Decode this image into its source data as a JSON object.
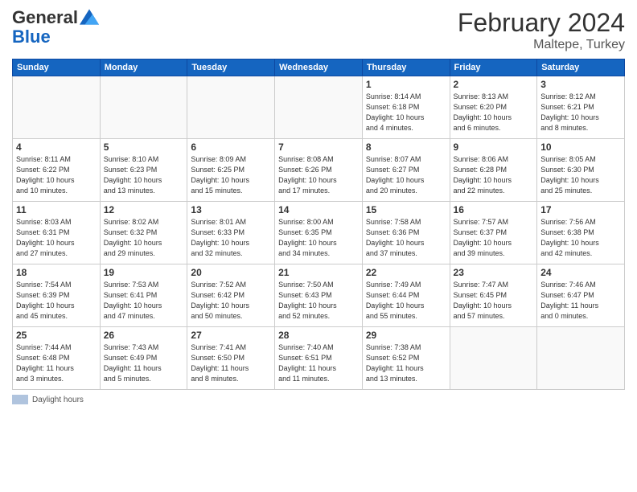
{
  "header": {
    "logo_general": "General",
    "logo_blue": "Blue",
    "title": "February 2024",
    "subtitle": "Maltepe, Turkey"
  },
  "footer": {
    "legend_label": "Daylight hours"
  },
  "days_of_week": [
    "Sunday",
    "Monday",
    "Tuesday",
    "Wednesday",
    "Thursday",
    "Friday",
    "Saturday"
  ],
  "weeks": [
    [
      {
        "day": "",
        "info": ""
      },
      {
        "day": "",
        "info": ""
      },
      {
        "day": "",
        "info": ""
      },
      {
        "day": "",
        "info": ""
      },
      {
        "day": "1",
        "info": "Sunrise: 8:14 AM\nSunset: 6:18 PM\nDaylight: 10 hours\nand 4 minutes."
      },
      {
        "day": "2",
        "info": "Sunrise: 8:13 AM\nSunset: 6:20 PM\nDaylight: 10 hours\nand 6 minutes."
      },
      {
        "day": "3",
        "info": "Sunrise: 8:12 AM\nSunset: 6:21 PM\nDaylight: 10 hours\nand 8 minutes."
      }
    ],
    [
      {
        "day": "4",
        "info": "Sunrise: 8:11 AM\nSunset: 6:22 PM\nDaylight: 10 hours\nand 10 minutes."
      },
      {
        "day": "5",
        "info": "Sunrise: 8:10 AM\nSunset: 6:23 PM\nDaylight: 10 hours\nand 13 minutes."
      },
      {
        "day": "6",
        "info": "Sunrise: 8:09 AM\nSunset: 6:25 PM\nDaylight: 10 hours\nand 15 minutes."
      },
      {
        "day": "7",
        "info": "Sunrise: 8:08 AM\nSunset: 6:26 PM\nDaylight: 10 hours\nand 17 minutes."
      },
      {
        "day": "8",
        "info": "Sunrise: 8:07 AM\nSunset: 6:27 PM\nDaylight: 10 hours\nand 20 minutes."
      },
      {
        "day": "9",
        "info": "Sunrise: 8:06 AM\nSunset: 6:28 PM\nDaylight: 10 hours\nand 22 minutes."
      },
      {
        "day": "10",
        "info": "Sunrise: 8:05 AM\nSunset: 6:30 PM\nDaylight: 10 hours\nand 25 minutes."
      }
    ],
    [
      {
        "day": "11",
        "info": "Sunrise: 8:03 AM\nSunset: 6:31 PM\nDaylight: 10 hours\nand 27 minutes."
      },
      {
        "day": "12",
        "info": "Sunrise: 8:02 AM\nSunset: 6:32 PM\nDaylight: 10 hours\nand 29 minutes."
      },
      {
        "day": "13",
        "info": "Sunrise: 8:01 AM\nSunset: 6:33 PM\nDaylight: 10 hours\nand 32 minutes."
      },
      {
        "day": "14",
        "info": "Sunrise: 8:00 AM\nSunset: 6:35 PM\nDaylight: 10 hours\nand 34 minutes."
      },
      {
        "day": "15",
        "info": "Sunrise: 7:58 AM\nSunset: 6:36 PM\nDaylight: 10 hours\nand 37 minutes."
      },
      {
        "day": "16",
        "info": "Sunrise: 7:57 AM\nSunset: 6:37 PM\nDaylight: 10 hours\nand 39 minutes."
      },
      {
        "day": "17",
        "info": "Sunrise: 7:56 AM\nSunset: 6:38 PM\nDaylight: 10 hours\nand 42 minutes."
      }
    ],
    [
      {
        "day": "18",
        "info": "Sunrise: 7:54 AM\nSunset: 6:39 PM\nDaylight: 10 hours\nand 45 minutes."
      },
      {
        "day": "19",
        "info": "Sunrise: 7:53 AM\nSunset: 6:41 PM\nDaylight: 10 hours\nand 47 minutes."
      },
      {
        "day": "20",
        "info": "Sunrise: 7:52 AM\nSunset: 6:42 PM\nDaylight: 10 hours\nand 50 minutes."
      },
      {
        "day": "21",
        "info": "Sunrise: 7:50 AM\nSunset: 6:43 PM\nDaylight: 10 hours\nand 52 minutes."
      },
      {
        "day": "22",
        "info": "Sunrise: 7:49 AM\nSunset: 6:44 PM\nDaylight: 10 hours\nand 55 minutes."
      },
      {
        "day": "23",
        "info": "Sunrise: 7:47 AM\nSunset: 6:45 PM\nDaylight: 10 hours\nand 57 minutes."
      },
      {
        "day": "24",
        "info": "Sunrise: 7:46 AM\nSunset: 6:47 PM\nDaylight: 11 hours\nand 0 minutes."
      }
    ],
    [
      {
        "day": "25",
        "info": "Sunrise: 7:44 AM\nSunset: 6:48 PM\nDaylight: 11 hours\nand 3 minutes."
      },
      {
        "day": "26",
        "info": "Sunrise: 7:43 AM\nSunset: 6:49 PM\nDaylight: 11 hours\nand 5 minutes."
      },
      {
        "day": "27",
        "info": "Sunrise: 7:41 AM\nSunset: 6:50 PM\nDaylight: 11 hours\nand 8 minutes."
      },
      {
        "day": "28",
        "info": "Sunrise: 7:40 AM\nSunset: 6:51 PM\nDaylight: 11 hours\nand 11 minutes."
      },
      {
        "day": "29",
        "info": "Sunrise: 7:38 AM\nSunset: 6:52 PM\nDaylight: 11 hours\nand 13 minutes."
      },
      {
        "day": "",
        "info": ""
      },
      {
        "day": "",
        "info": ""
      }
    ]
  ]
}
